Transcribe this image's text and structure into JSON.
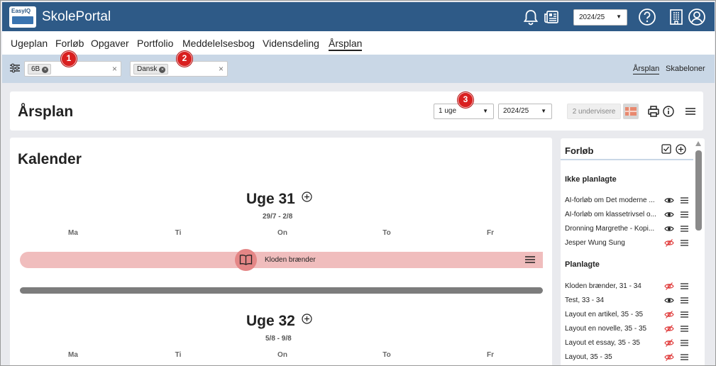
{
  "app": {
    "logo_text": "EasyIQ",
    "title": "SkolePortal"
  },
  "topbar": {
    "year_select": "2024/25",
    "icons": [
      "bell-icon",
      "news-icon",
      "help-icon",
      "building-icon",
      "user-icon"
    ]
  },
  "nav": {
    "items": [
      "Ugeplan",
      "Forløb",
      "Opgaver",
      "Portfolio",
      "Meddelelsesbog",
      "Vidensdeling",
      "Årsplan"
    ],
    "active": "Årsplan"
  },
  "badges": [
    "1",
    "2",
    "3"
  ],
  "filters": {
    "class_chip": "6B",
    "subject_chip": "Dansk",
    "sublinks": [
      "Årsplan",
      "Skabeloner"
    ],
    "active_sublink": "Årsplan"
  },
  "header": {
    "title": "Årsplan",
    "period_select": "1 uge",
    "year_select": "2024/25",
    "teachers_button": "2 undervisere"
  },
  "calendar": {
    "title": "Kalender",
    "weeks": [
      {
        "title": "Uge 31",
        "dates": "29/7 - 2/8",
        "days": [
          "Ma",
          "Ti",
          "On",
          "To",
          "Fr"
        ]
      },
      {
        "title": "Uge 32",
        "dates": "5/8 - 9/8",
        "days": [
          "Ma",
          "Ti",
          "On",
          "To",
          "Fr"
        ]
      }
    ],
    "event": {
      "label": "Kloden brænder",
      "color": "#f0bdbd"
    }
  },
  "sidebar": {
    "title": "Forløb",
    "unplanned_heading": "Ikke planlagte",
    "unplanned": [
      {
        "label": "AI-forløb om Det moderne ...",
        "visible": true
      },
      {
        "label": "AI-forløb om klassetrivsel o...",
        "visible": true
      },
      {
        "label": "Dronning Margrethe - Kopi...",
        "visible": true
      },
      {
        "label": "Jesper Wung Sung",
        "visible": false
      }
    ],
    "planned_heading": "Planlagte",
    "planned": [
      {
        "label": "Kloden brænder, 31 - 34",
        "visible": false
      },
      {
        "label": "Test, 33 - 34",
        "visible": true
      },
      {
        "label": "Layout en artikel, 35 - 35",
        "visible": false
      },
      {
        "label": "Layout en novelle, 35 - 35",
        "visible": false
      },
      {
        "label": "Layout et essay, 35 - 35",
        "visible": false
      },
      {
        "label": "Layout, 35 - 35",
        "visible": false
      }
    ]
  },
  "colors": {
    "brand": "#2e5a87",
    "filter_bar": "#c9d7e6",
    "badge": "#d91f1f",
    "event": "#f0bdbd"
  }
}
